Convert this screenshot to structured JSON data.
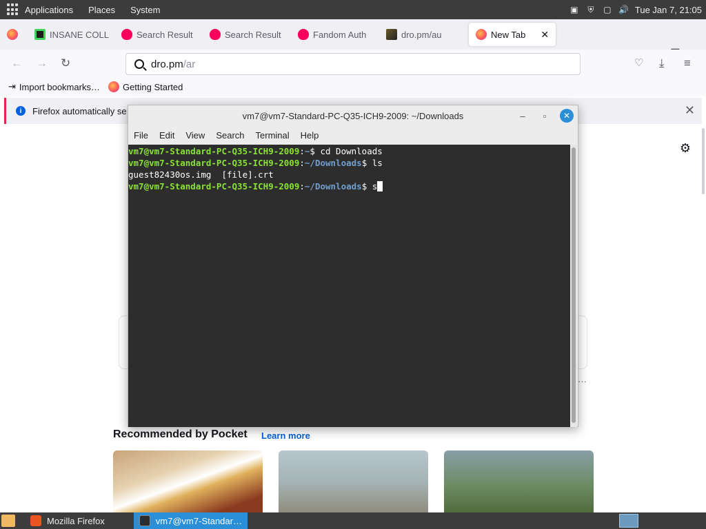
{
  "system_bar": {
    "menus": [
      "Applications",
      "Places",
      "System"
    ],
    "datetime": "Tue Jan  7, 21:05"
  },
  "firefox": {
    "tabs": [
      {
        "label": "",
        "favicon": "firefox-icon"
      },
      {
        "label": "INSANE COLL",
        "favicon": "green-square-icon"
      },
      {
        "label": "Search Result",
        "favicon": "fandom-icon"
      },
      {
        "label": "Search Result",
        "favicon": "fandom-icon"
      },
      {
        "label": "Fandom Auth",
        "favicon": "fandom-icon"
      },
      {
        "label": "dro.pm/au",
        "favicon": "image-icon"
      },
      {
        "label": "New Tab",
        "favicon": "firefox-icon",
        "active": true
      }
    ],
    "url_host": "dro.pm",
    "url_path": "/ar",
    "bookmarks": {
      "import": "Import bookmarks…",
      "getting_started": "Getting Started"
    },
    "notification": "Firefox automatically se",
    "pocket": {
      "title": "Recommended by Pocket",
      "learn_more": "Learn more"
    },
    "more_dots": "···"
  },
  "terminal": {
    "title": "vm7@vm7-Standard-PC-Q35-ICH9-2009: ~/Downloads",
    "menu": [
      "File",
      "Edit",
      "View",
      "Search",
      "Terminal",
      "Help"
    ],
    "lines": [
      {
        "user": "vm7@vm7-Standard-PC-Q35-ICH9-2009",
        "path": "~",
        "cmd": " cd Downloads"
      },
      {
        "user": "vm7@vm7-Standard-PC-Q35-ICH9-2009",
        "path": "~/Downloads",
        "cmd": " ls"
      },
      {
        "output": "guest82430os.img  [file].crt"
      },
      {
        "user": "vm7@vm7-Standard-PC-Q35-ICH9-2009",
        "path": "~/Downloads",
        "cmd": " s"
      }
    ]
  },
  "taskbar": {
    "items": [
      {
        "label": "Mozilla Firefox",
        "active": false
      },
      {
        "label": "vm7@vm7-Standar…",
        "active": true
      }
    ]
  },
  "colors": {
    "prompt_user": "#8ae234",
    "prompt_path": "#729fcf",
    "terminal_bg": "#2d2d2d",
    "accent": "#2b8fd8"
  }
}
